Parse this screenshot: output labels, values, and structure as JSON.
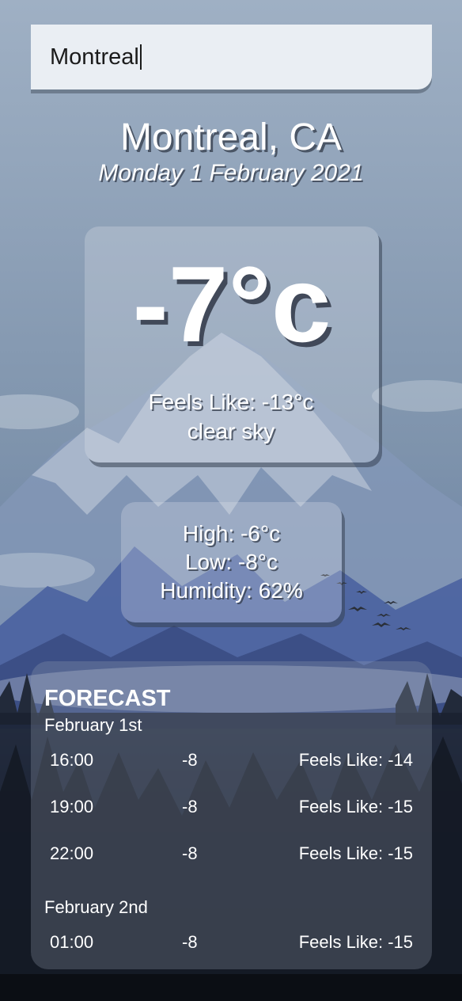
{
  "search": {
    "value": "Montreal"
  },
  "location": {
    "city": "Montreal, CA",
    "date": "Monday 1 February 2021"
  },
  "current": {
    "temperature": "-7°c",
    "feels_like": "Feels Like: -13°c",
    "condition": "clear sky"
  },
  "stats": {
    "high": "High: -6°c",
    "low": "Low: -8°c",
    "humidity": "Humidity: 62%"
  },
  "forecast": {
    "title": "FORECAST",
    "days": [
      {
        "label": "February 1st",
        "rows": [
          {
            "time": "16:00",
            "temp": "-8",
            "feels": "Feels Like: -14"
          },
          {
            "time": "19:00",
            "temp": "-8",
            "feels": "Feels Like: -15"
          },
          {
            "time": "22:00",
            "temp": "-8",
            "feels": "Feels Like: -15"
          }
        ]
      },
      {
        "label": "February 2nd",
        "rows": [
          {
            "time": "01:00",
            "temp": "-8",
            "feels": "Feels Like: -15"
          }
        ]
      }
    ]
  },
  "theme": {
    "sky_top": "#9fb0c4",
    "mountain_far": "#7f95b5",
    "mountain_near": "#3f5a96",
    "forest": "#1c2333"
  }
}
